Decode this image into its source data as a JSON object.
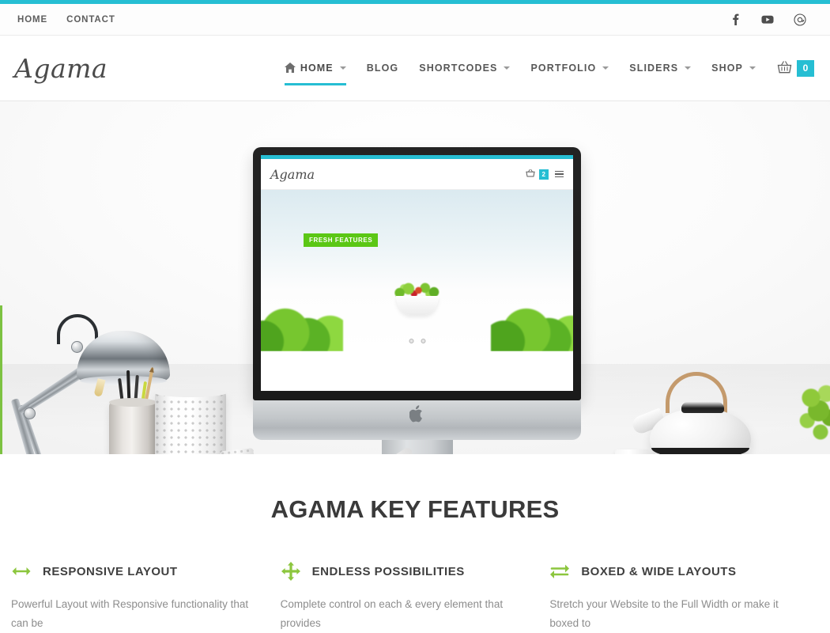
{
  "topbar": {
    "links": [
      {
        "label": "HOME"
      },
      {
        "label": "CONTACT"
      }
    ],
    "social": [
      {
        "name": "facebook-icon",
        "glyph": "f"
      },
      {
        "name": "youtube-icon",
        "glyph": "▶"
      },
      {
        "name": "at-icon",
        "glyph": "@"
      }
    ]
  },
  "header": {
    "logo": "Agama",
    "nav": [
      {
        "label": "HOME",
        "has_caret": true,
        "active": true,
        "icon": "home-icon"
      },
      {
        "label": "BLOG",
        "has_caret": false,
        "active": false
      },
      {
        "label": "SHORTCODES",
        "has_caret": true,
        "active": false
      },
      {
        "label": "PORTFOLIO",
        "has_caret": true,
        "active": false
      },
      {
        "label": "SLIDERS",
        "has_caret": true,
        "active": false
      },
      {
        "label": "SHOP",
        "has_caret": true,
        "active": false
      }
    ],
    "cart": {
      "icon": "basket-icon",
      "count": "0"
    }
  },
  "hero": {
    "screen": {
      "logo": "Agama",
      "cart_count": "2",
      "badge": "FRESH FEATURES"
    }
  },
  "features": {
    "title": "AGAMA KEY FEATURES",
    "items": [
      {
        "icon": "arrows-horizontal-icon",
        "title": "RESPONSIVE LAYOUT",
        "text": "Powerful Layout with Responsive functionality that can be"
      },
      {
        "icon": "arrows-move-icon",
        "title": "ENDLESS POSSIBILITIES",
        "text": "Complete control on each & every element that provides"
      },
      {
        "icon": "arrows-exchange-icon",
        "title": "BOXED & WIDE LAYOUTS",
        "text": "Stretch your Website to the Full Width or make it boxed to"
      }
    ]
  },
  "colors": {
    "accent": "#26bed3",
    "green": "#8cc63e",
    "badge_green": "#5bc715",
    "text_dark": "#3a3a3a",
    "text_muted": "#8d8d8d"
  }
}
